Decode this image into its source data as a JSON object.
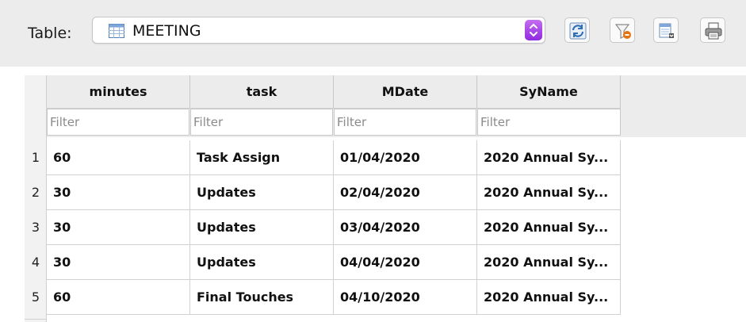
{
  "toolbar": {
    "table_label": "Table:",
    "selected_table": "MEETING",
    "icons": [
      "table-icon",
      "refresh-icon",
      "clear-filter-icon",
      "save-export-icon",
      "print-icon"
    ]
  },
  "grid": {
    "columns": [
      {
        "header": "minutes",
        "filter_placeholder": "Filter"
      },
      {
        "header": "task",
        "filter_placeholder": "Filter"
      },
      {
        "header": "MDate",
        "filter_placeholder": "Filter"
      },
      {
        "header": "SyName",
        "filter_placeholder": "Filter"
      }
    ],
    "rows": [
      {
        "num": "1",
        "minutes": "60",
        "task": "Task Assign",
        "mdate": "01/04/2020",
        "syname": "2020 Annual Sy..."
      },
      {
        "num": "2",
        "minutes": "30",
        "task": "Updates",
        "mdate": "02/04/2020",
        "syname": "2020 Annual Sy..."
      },
      {
        "num": "3",
        "minutes": "30",
        "task": "Updates",
        "mdate": "03/04/2020",
        "syname": "2020 Annual Sy..."
      },
      {
        "num": "4",
        "minutes": "30",
        "task": "Updates",
        "mdate": "04/04/2020",
        "syname": "2020 Annual Sy..."
      },
      {
        "num": "5",
        "minutes": "60",
        "task": "Final Touches",
        "mdate": "04/10/2020",
        "syname": "2020 Annual Sy..."
      }
    ]
  },
  "colors": {
    "accent_stepper": "#9b3fe6",
    "toolbar_bg": "#ececec"
  }
}
